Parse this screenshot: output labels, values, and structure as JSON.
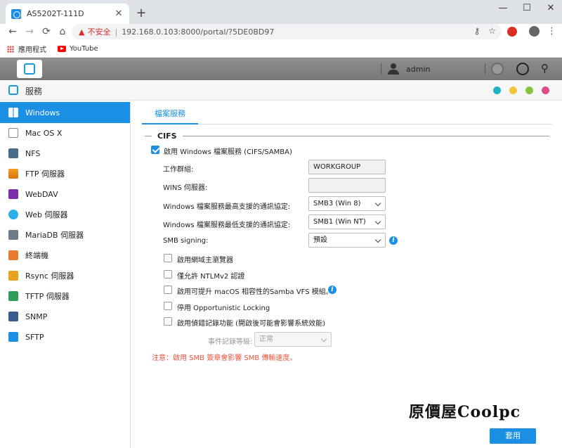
{
  "browser": {
    "tab_title": "AS5202T-111D",
    "tab_close": "✕",
    "new_tab": "+",
    "minimize": "—",
    "maximize": "☐",
    "close": "✕",
    "back": "←",
    "forward": "→",
    "reload": "⟳",
    "home": "⌂",
    "warning_icon": "▲",
    "insecure_label": "不安全",
    "separator": "|",
    "url": "192.168.0.103:8000/portal/?5DE0BD97",
    "key_icon": "⚷",
    "star_icon": "☆",
    "menu_icon": "⋮",
    "bookmarks": {
      "apps_label": "應用程式",
      "youtube_label": "YouTube"
    }
  },
  "nas": {
    "username": "admin"
  },
  "app": {
    "title": "服務",
    "window_dots": [
      "#1fb2c4",
      "#f4c43b",
      "#86c440",
      "#e24b8a"
    ]
  },
  "sidebar": {
    "items": [
      {
        "label": "Windows",
        "icon": "windows-icon",
        "active": true
      },
      {
        "label": "Mac OS X",
        "icon": "mac-icon"
      },
      {
        "label": "NFS",
        "icon": "nfs-icon"
      },
      {
        "label": "FTP 伺服器",
        "icon": "ftp-icon"
      },
      {
        "label": "WebDAV",
        "icon": "webdav-icon"
      },
      {
        "label": "Web 伺服器",
        "icon": "web-server-icon"
      },
      {
        "label": "MariaDB 伺服器",
        "icon": "mariadb-icon"
      },
      {
        "label": "終端機",
        "icon": "terminal-icon"
      },
      {
        "label": "Rsync 伺服器",
        "icon": "rsync-icon"
      },
      {
        "label": "TFTP 伺服器",
        "icon": "tftp-icon"
      },
      {
        "label": "SNMP",
        "icon": "snmp-icon"
      },
      {
        "label": "SFTP",
        "icon": "sftp-icon"
      }
    ]
  },
  "main": {
    "tab_label": "檔案服務",
    "section_title": "CIFS",
    "enable_label": "啟用 Windows 檔案服務 (CIFS/SAMBA)",
    "fields": {
      "workgroup_label": "工作群組:",
      "workgroup_value": "WORKGROUP",
      "wins_label": "WINS 伺服器:",
      "wins_value": "",
      "max_proto_label": "Windows 檔案服務最高支援的通訊協定:",
      "max_proto_value": "SMB3 (Win 8)",
      "min_proto_label": "Windows 檔案服務最低支援的通訊協定:",
      "min_proto_value": "SMB1 (Win NT)",
      "signing_label": "SMB signing:",
      "signing_value": "預設",
      "info_glyph": "i"
    },
    "options": {
      "master_browser": "啟用網域主瀏覽器",
      "ntlmv2": "僅允許 NTLMv2 認證",
      "macos_vfs": "啟用可提升 macOS 相容性的Samba VFS 模組。",
      "oplocks": "停用 Opportunistic Locking",
      "debug_log": "啟用偵錯記錄功能 (開啟後可能會影響系統效能)"
    },
    "log_level_label": "事件記錄等級:",
    "log_level_value": "正常",
    "note": "注意：啟用 SMB 簽章會影響 SMB 傳輸速度。",
    "apply_label": "套用"
  },
  "watermark": "原價屋Coolpc"
}
